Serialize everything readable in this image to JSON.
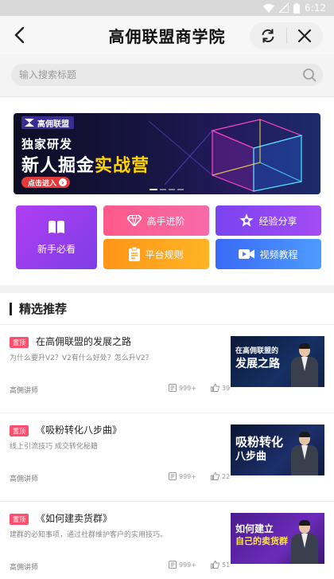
{
  "status_bar": {
    "time": "6:12"
  },
  "header": {
    "title": "高佣联盟商学院"
  },
  "search": {
    "placeholder": "输入搜索标题"
  },
  "banner": {
    "logo_text": "高佣联盟",
    "subtitle": "独家研发",
    "title_part1": "新人掘金",
    "title_part2": "实战营",
    "cta": "点击进入"
  },
  "menu": {
    "beginner": "新手必看",
    "advanced": "高手进阶",
    "experience": "经验分享",
    "rules": "平台规则",
    "video": "视频教程"
  },
  "section": {
    "title": "精选推荐"
  },
  "articles": [
    {
      "tag": "置顶",
      "title": "在高佣联盟的发展之路",
      "desc": "为什么要升V2？V2有什么好处？怎么升V2？",
      "author": "高佣讲师",
      "views": "999+",
      "likes": "39",
      "thumb_line1": "在高佣联盟的",
      "thumb_line2": "发展之路"
    },
    {
      "tag": "置顶",
      "title": "《吸粉转化八步曲》",
      "desc": "线上引流技巧 成交转化秘籍",
      "author": "高佣讲师",
      "views": "999+",
      "likes": "22",
      "thumb_line1": "吸粉转化",
      "thumb_line2": "八步曲"
    },
    {
      "tag": "置顶",
      "title": "《如何建卖货群》",
      "desc": "建群的必知事项，通过社群维护客户的实用技巧。",
      "author": "高佣讲师",
      "views": "999+",
      "likes": "51",
      "thumb_line1": "如何建立",
      "thumb_line2": "自己的卖货群"
    }
  ]
}
